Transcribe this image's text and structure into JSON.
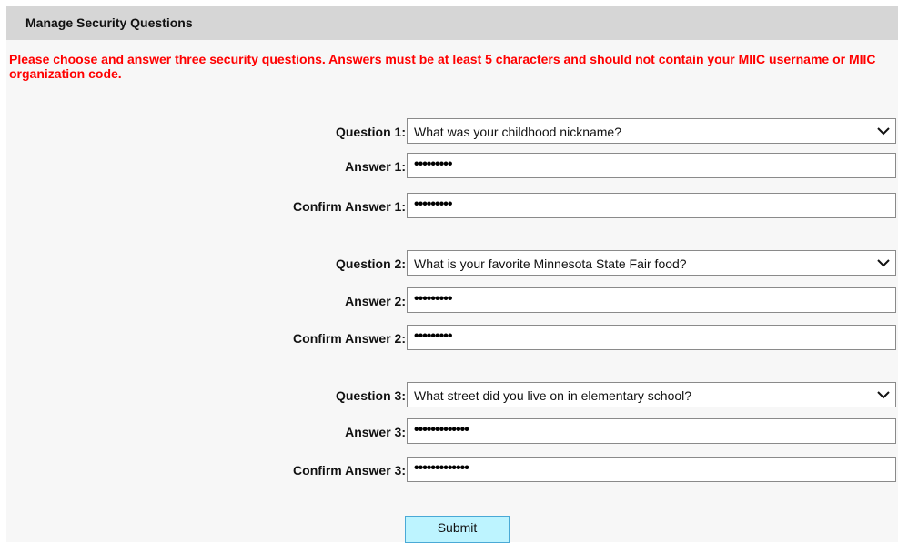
{
  "header": {
    "title": "Manage Security Questions"
  },
  "instructions": "Please choose and answer three security questions. Answers must be at least 5 characters and should not contain your MIIC username or MIIC organization code.",
  "questions": [
    {
      "question_label": "Question 1:",
      "question_value": "What was your childhood nickname?",
      "answer_label": "Answer 1:",
      "answer_value": "•••••••••",
      "confirm_label": "Confirm Answer 1:",
      "confirm_value": "•••••••••"
    },
    {
      "question_label": "Question 2:",
      "question_value": "What is your favorite Minnesota State Fair food?",
      "answer_label": "Answer 2:",
      "answer_value": "•••••••••",
      "confirm_label": "Confirm Answer 2:",
      "confirm_value": "•••••••••"
    },
    {
      "question_label": "Question 3:",
      "question_value": "What street did you live on in elementary school?",
      "answer_label": "Answer 3:",
      "answer_value": "•••••••••••••",
      "confirm_label": "Confirm Answer 3:",
      "confirm_value": "•••••••••••••"
    }
  ],
  "submit_label": "Submit",
  "colors": {
    "header_bg": "#d6d6d6",
    "instruction_text": "#ff0000",
    "submit_bg": "#bdf4ff"
  }
}
